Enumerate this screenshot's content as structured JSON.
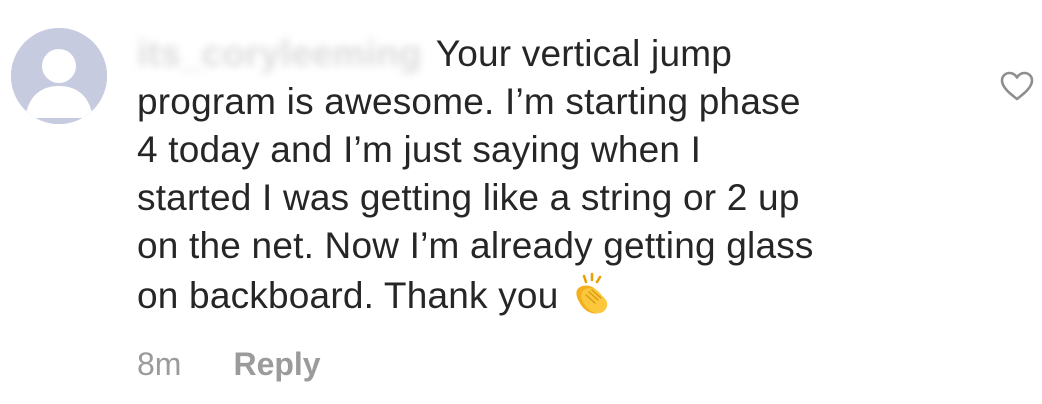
{
  "comment": {
    "username": "its_coryleeming",
    "text_lines": [
      "Your vertical jump",
      "program is awesome. I’m starting phase",
      "4 today and I’m just saying when I",
      "started I was getting like a string or 2 up",
      "on the net. Now I’m already getting glass",
      "on backboard. Thank you"
    ],
    "emoji_icon": "clapping-hands-icon",
    "time": "8m",
    "reply_label": "Reply",
    "like_icon": "heart-outline-icon"
  },
  "colors": {
    "text": "#262626",
    "meta": "#9b9b9b",
    "avatar_bg": "#c7cbe0"
  }
}
